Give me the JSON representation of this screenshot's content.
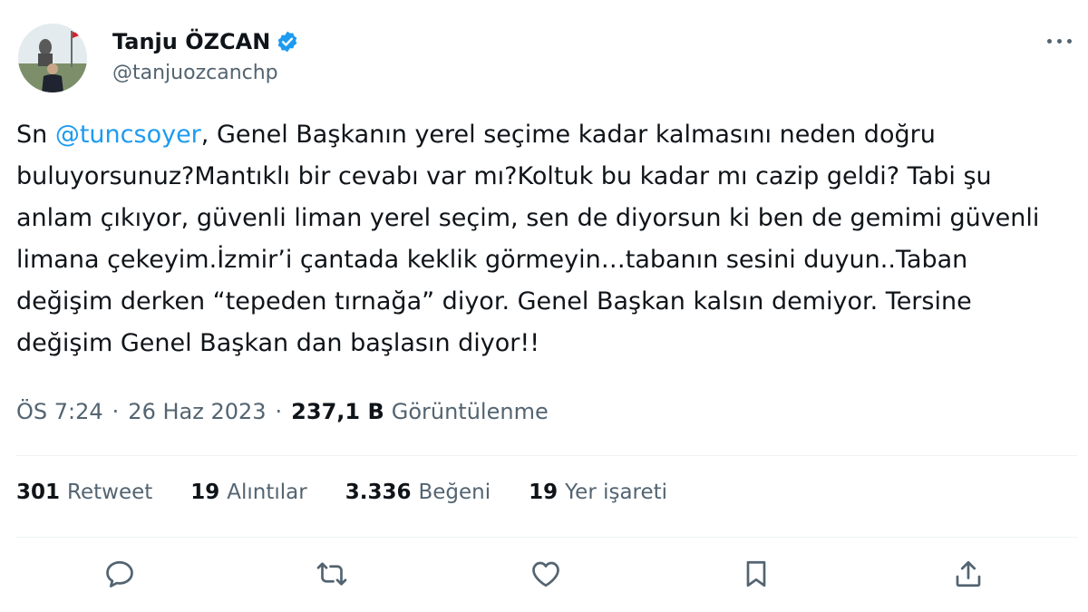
{
  "author": {
    "name": "Tanju ÖZCAN",
    "handle": "@tanjuozcanchp",
    "verified_color": "#1d9bf0"
  },
  "tweet": {
    "prefix": "Sn ",
    "mention": "@tuncsoyer",
    "body": ", Genel Başkanın yerel seçime kadar kalmasını neden doğru buluyorsunuz?Mantıklı bir cevabı var mı?Koltuk bu kadar mı cazip geldi? Tabi şu anlam çıkıyor, güvenli liman yerel seçim, sen de diyorsun ki ben de gemimi güvenli limana çekeyim.İzmir’i çantada keklik görmeyin…tabanın sesini duyun..Taban değişim derken “tepeden tırnağa” diyor. Genel Başkan kalsın demiyor. Tersine değişim Genel Başkan dan başlasın diyor!!"
  },
  "meta": {
    "time": "ÖS 7:24",
    "date": "26 Haz 2023",
    "views_count": "237,1 B",
    "views_label": "Görüntülenme",
    "separator": "·"
  },
  "stats": {
    "retweets": {
      "count": "301",
      "label": "Retweet"
    },
    "quotes": {
      "count": "19",
      "label": "Alıntılar"
    },
    "likes": {
      "count": "3.336",
      "label": "Beğeni"
    },
    "bookmarks": {
      "count": "19",
      "label": "Yer işareti"
    }
  },
  "icons": {
    "reply": "reply-icon",
    "retweet": "retweet-icon",
    "like": "heart-icon",
    "bookmark": "bookmark-icon",
    "share": "share-icon",
    "more": "more-icon"
  },
  "colors": {
    "accent": "#1d9bf0",
    "text": "#0f1419",
    "secondary": "#536471",
    "icon": "#536471"
  }
}
